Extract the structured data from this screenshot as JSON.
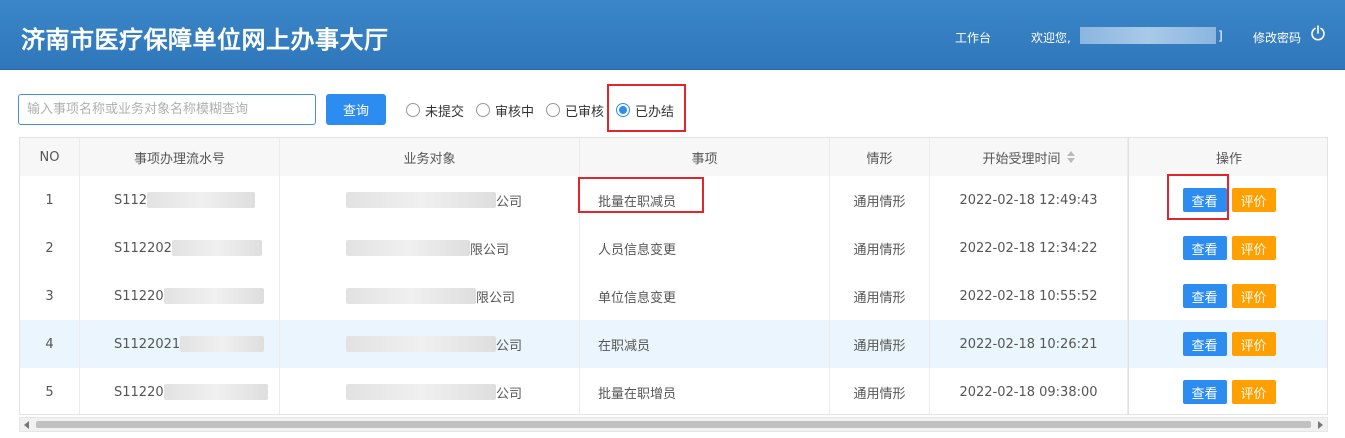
{
  "header": {
    "title": "济南市医疗保障单位网上办事大厅",
    "workbench": "工作台",
    "welcome": "欢迎您,",
    "user_suffix": "]",
    "change_password": "修改密码"
  },
  "search": {
    "placeholder": "输入事项名称或业务对象名称模糊查询",
    "button": "查询"
  },
  "status_filters": [
    {
      "label": "未提交",
      "checked": false
    },
    {
      "label": "审核中",
      "checked": false
    },
    {
      "label": "已审核",
      "checked": false
    },
    {
      "label": "已办结",
      "checked": true
    }
  ],
  "table": {
    "columns": [
      "NO",
      "事项办理流水号",
      "业务对象",
      "事项",
      "情形",
      "开始受理时间",
      "操作"
    ],
    "rows": [
      {
        "no": "1",
        "serial": "S112",
        "object": "公司",
        "item": "批量在职减员",
        "case": "通用情形",
        "time": "2022-02-18 12:49:43"
      },
      {
        "no": "2",
        "serial": "S112202",
        "object": "限公司",
        "item": "人员信息变更",
        "case": "通用情形",
        "time": "2022-02-18 12:34:22"
      },
      {
        "no": "3",
        "serial": "S11220",
        "object": "限公司",
        "item": "单位信息变更",
        "case": "通用情形",
        "time": "2022-02-18 10:55:52"
      },
      {
        "no": "4",
        "serial": "S1122021",
        "object": "公司",
        "item": "在职减员",
        "case": "通用情形",
        "time": "2022-02-18 10:26:21"
      },
      {
        "no": "5",
        "serial": "S11220",
        "object": "公司",
        "item": "批量在职增员",
        "case": "通用情形",
        "time": "2022-02-18 09:38:00"
      }
    ],
    "view_label": "查看",
    "rate_label": "评价"
  },
  "colors": {
    "header_bg": "#2f7fc1",
    "primary": "#2d8cf0",
    "warning": "#ff9f00",
    "highlight_row": "#eaf5fd",
    "annotation_red": "#e0262b"
  }
}
